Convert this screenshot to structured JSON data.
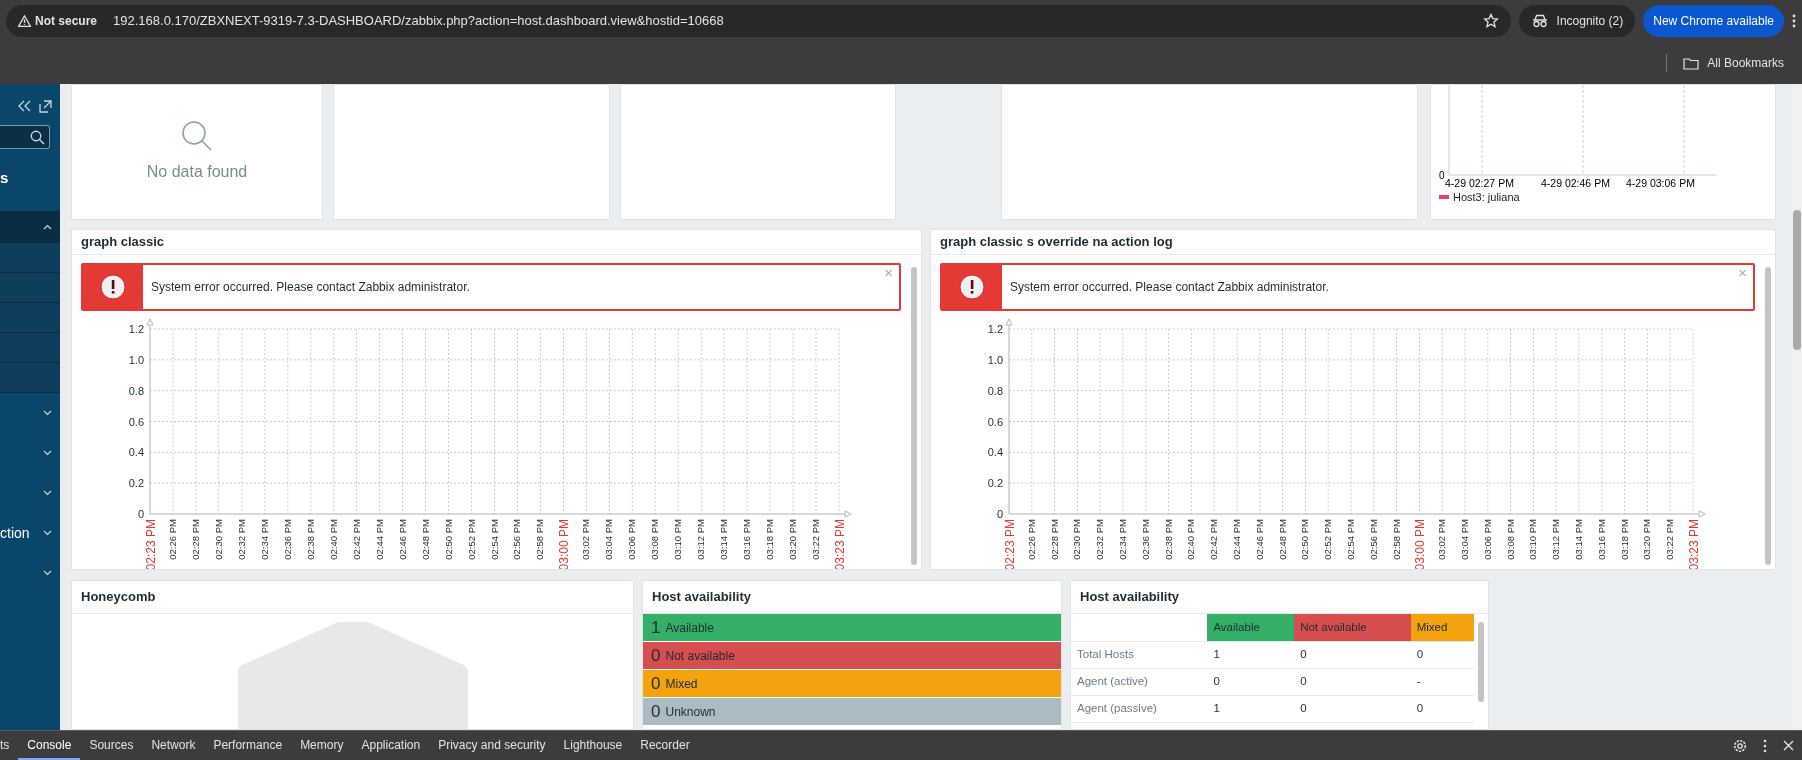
{
  "browser": {
    "security": "Not secure",
    "url": "192.168.0.170/ZBXNEXT-9319-7.3-DASHBOARD/zabbix.php?action=host.dashboard.view&hostid=10668",
    "incognito": "Incognito (2)",
    "update": "New Chrome available",
    "bookmarks": "All Bookmarks"
  },
  "sidebar": {
    "heading": "s",
    "sections": [
      {
        "expanded": true
      },
      {
        "expanded": false
      },
      {
        "expanded": false
      },
      {
        "expanded": false
      },
      {
        "expanded": false,
        "label": "ction"
      },
      {
        "expanded": false
      }
    ]
  },
  "top_widgets": [
    {
      "kind": "nodata",
      "message": "No data found"
    },
    {
      "kind": "empty"
    },
    {
      "kind": "empty"
    },
    {
      "kind": "empty"
    },
    {
      "kind": "graph",
      "y_label": "0",
      "x_labels": [
        "4-29 02:27 PM",
        "4-29 02:46 PM",
        "4-29 03:06 PM"
      ],
      "legend": [
        {
          "label": "Host3: juliana",
          "color": "#f2405a"
        }
      ]
    }
  ],
  "graph_widgets": [
    {
      "title": "graph classic",
      "error": "System error occurred. Please contact Zabbix administrator.",
      "close": "×",
      "x_label_marks": [
        {
          "highlighted": true
        },
        {
          "highlighted": false
        },
        {
          "highlighted": false
        },
        {
          "highlighted": false
        },
        {
          "highlighted": false
        },
        {
          "highlighted": false
        },
        {
          "highlighted": false
        },
        {
          "highlighted": false
        },
        {
          "highlighted": false
        },
        {
          "highlighted": false
        },
        {
          "highlighted": false
        },
        {
          "highlighted": false
        },
        {
          "highlighted": false
        },
        {
          "highlighted": false
        },
        {
          "highlighted": false
        },
        {
          "highlighted": false
        },
        {
          "highlighted": false
        },
        {
          "highlighted": false
        },
        {
          "highlighted": true
        },
        {
          "highlighted": false
        },
        {
          "highlighted": false
        },
        {
          "highlighted": false
        },
        {
          "highlighted": false
        },
        {
          "highlighted": false
        },
        {
          "highlighted": false
        },
        {
          "highlighted": false
        },
        {
          "highlighted": false
        },
        {
          "highlighted": false
        },
        {
          "highlighted": false
        },
        {
          "highlighted": false
        },
        {
          "highlighted": true
        }
      ],
      "chart_data": {
        "type": "line",
        "grid": true,
        "ylim": [
          0,
          1.2
        ],
        "yticks": [
          0,
          0.2,
          0.4,
          0.6,
          0.8,
          {
            "value": 1,
            "label": "1.0"
          },
          1.2
        ],
        "categories": [
          "02:23 PM",
          "02:26 PM",
          "02:28 PM",
          "02:30 PM",
          "02:32 PM",
          "02:34 PM",
          "02:36 PM",
          "02:38 PM",
          "02:40 PM",
          "02:42 PM",
          "02:44 PM",
          "02:46 PM",
          "02:48 PM",
          "02:50 PM",
          "02:52 PM",
          "02:54 PM",
          "02:56 PM",
          "02:58 PM",
          "03:00 PM",
          "03:02 PM",
          "03:04 PM",
          "03:06 PM",
          "03:08 PM",
          "03:10 PM",
          "03:12 PM",
          "03:14 PM",
          "03:16 PM",
          "03:18 PM",
          "03:20 PM",
          "03:22 PM",
          "03:23 PM"
        ]
      }
    },
    {
      "title": "graph classic s override na action log",
      "error": "System error occurred. Please contact Zabbix administrator.",
      "close": "×",
      "x_label_marks": [
        {
          "highlighted": true
        },
        {
          "highlighted": false
        },
        {
          "highlighted": false
        },
        {
          "highlighted": false
        },
        {
          "highlighted": false
        },
        {
          "highlighted": false
        },
        {
          "highlighted": false
        },
        {
          "highlighted": false
        },
        {
          "highlighted": false
        },
        {
          "highlighted": false
        },
        {
          "highlighted": false
        },
        {
          "highlighted": false
        },
        {
          "highlighted": false
        },
        {
          "highlighted": false
        },
        {
          "highlighted": false
        },
        {
          "highlighted": false
        },
        {
          "highlighted": false
        },
        {
          "highlighted": false
        },
        {
          "highlighted": true
        },
        {
          "highlighted": false
        },
        {
          "highlighted": false
        },
        {
          "highlighted": false
        },
        {
          "highlighted": false
        },
        {
          "highlighted": false
        },
        {
          "highlighted": false
        },
        {
          "highlighted": false
        },
        {
          "highlighted": false
        },
        {
          "highlighted": false
        },
        {
          "highlighted": false
        },
        {
          "highlighted": false
        },
        {
          "highlighted": true
        }
      ],
      "chart_data": {
        "type": "line",
        "grid": true,
        "ylim": [
          0,
          1.2
        ],
        "yticks": [
          0,
          0.2,
          0.4,
          0.6,
          0.8,
          {
            "value": 1,
            "label": "1.0"
          },
          1.2
        ],
        "categories": [
          "02:23 PM",
          "02:26 PM",
          "02:28 PM",
          "02:30 PM",
          "02:32 PM",
          "02:34 PM",
          "02:36 PM",
          "02:38 PM",
          "02:40 PM",
          "02:42 PM",
          "02:44 PM",
          "02:46 PM",
          "02:48 PM",
          "02:50 PM",
          "02:52 PM",
          "02:54 PM",
          "02:56 PM",
          "02:58 PM",
          "03:00 PM",
          "03:02 PM",
          "03:04 PM",
          "03:06 PM",
          "03:08 PM",
          "03:10 PM",
          "03:12 PM",
          "03:14 PM",
          "03:16 PM",
          "03:18 PM",
          "03:20 PM",
          "03:22 PM",
          "03:23 PM"
        ]
      }
    }
  ],
  "honeycomb": {
    "title": "Honeycomb"
  },
  "host_availability": {
    "title": "Host availability",
    "rows": [
      {
        "count": "1",
        "label": "Available",
        "color": "#34af67"
      },
      {
        "count": "0",
        "label": "Not available",
        "color": "#d64e4e"
      },
      {
        "count": "0",
        "label": "Mixed",
        "color": "#f4a20d"
      },
      {
        "count": "0",
        "label": "Unknown",
        "color": "#acbbc2"
      }
    ]
  },
  "host_availability_table": {
    "title": "Host availability",
    "columns": [
      {
        "label": "Available",
        "color": "#34af67"
      },
      {
        "label": "Not available",
        "color": "#d64e4e"
      },
      {
        "label": "Mixed",
        "color": "#f4a20d"
      }
    ],
    "rows": [
      {
        "name": "Total Hosts",
        "cells": [
          "1",
          "0",
          "0"
        ]
      },
      {
        "name": "Agent (active)",
        "cells": [
          "0",
          "0",
          "-"
        ]
      },
      {
        "name": "Agent (passive)",
        "cells": [
          "1",
          "0",
          "0"
        ]
      }
    ]
  },
  "devtools": {
    "tabs": [
      {
        "label": "ts",
        "selected": false
      },
      {
        "label": "Console",
        "selected": true
      },
      {
        "label": "Sources",
        "selected": false
      },
      {
        "label": "Network",
        "selected": false
      },
      {
        "label": "Performance",
        "selected": false
      },
      {
        "label": "Memory",
        "selected": false
      },
      {
        "label": "Application",
        "selected": false
      },
      {
        "label": "Privacy and security",
        "selected": false
      },
      {
        "label": "Lighthouse",
        "selected": false
      },
      {
        "label": "Recorder",
        "selected": false
      }
    ]
  }
}
